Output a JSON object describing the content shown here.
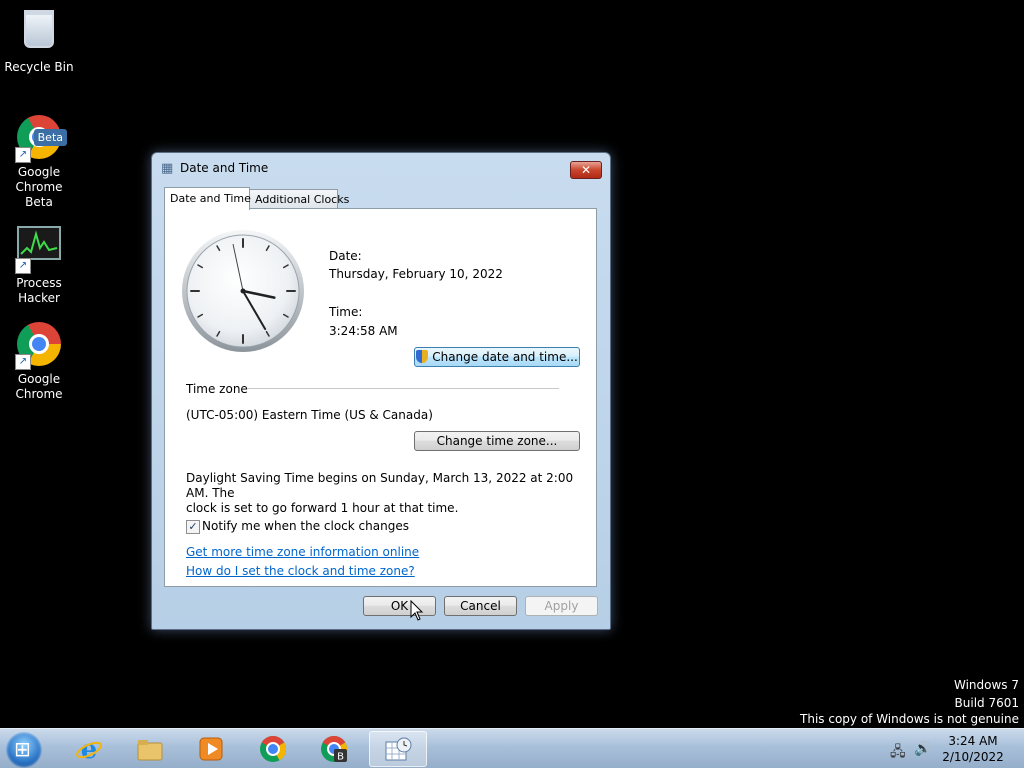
{
  "desktop": {
    "icons": [
      {
        "label": "Recycle Bin",
        "icon": "recycle-bin-icon"
      },
      {
        "label": "Google\nChrome Beta",
        "icon": "chrome-beta-icon",
        "badge": "Beta"
      },
      {
        "label": "Process\nHacker",
        "icon": "process-hacker-icon"
      },
      {
        "label": "Google\nChrome",
        "icon": "chrome-icon"
      }
    ],
    "watermark": [
      "Windows 7",
      "Build 7601",
      "This copy of Windows is not genuine"
    ]
  },
  "dialog": {
    "title": "Date and Time",
    "close_glyph": "✕",
    "tabs": [
      {
        "label": "Date and Time",
        "active": true
      },
      {
        "label": "Additional Clocks",
        "active": false
      }
    ],
    "clock": {
      "hour": 3,
      "minute": 24,
      "second": 58
    },
    "date_label": "Date:",
    "date_value": "Thursday, February 10, 2022",
    "time_label": "Time:",
    "time_value": "3:24:58 AM",
    "change_date_button": "Change date and time...",
    "timezone_heading": "Time zone",
    "timezone_value": "(UTC-05:00) Eastern Time (US & Canada)",
    "change_timezone_button": "Change time zone...",
    "dst_message": "Daylight Saving Time begins on Sunday, March 13, 2022 at 2:00 AM. The\nclock is set to go forward 1 hour at that time.",
    "notify_checked": true,
    "notify_label": "Notify me when the clock changes",
    "link_more_info": "Get more time zone information online",
    "link_how_to": "How do I set the clock and time zone?",
    "ok_button": "OK",
    "cancel_button": "Cancel",
    "apply_button": "Apply"
  },
  "taskbar": {
    "items": [
      "internet-explorer",
      "windows-explorer",
      "media-player",
      "google-chrome",
      "chrome-beta",
      "date-and-time"
    ],
    "clock_time": "3:24 AM",
    "clock_date": "2/10/2022"
  }
}
